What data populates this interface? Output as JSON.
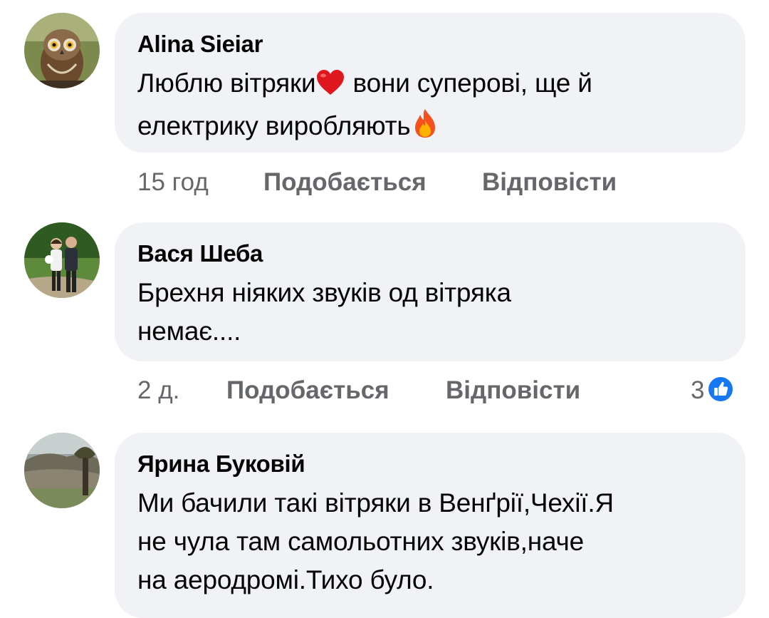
{
  "comments": [
    {
      "author": "Alina Sieiar",
      "line1_a": "Люблю вітряки",
      "line1_b": " вони суперові, ще й",
      "line2": "електрику виробляють",
      "time": "15 год",
      "like_label": "Подобається",
      "reply_label": "Відповісти",
      "emojis": [
        "heart-emoji",
        "fire-emoji"
      ],
      "avatar": "owl-avatar"
    },
    {
      "author": "Вася Шеба",
      "line1": "Брехня ніяких звуків од вітряка",
      "line2": "немає....",
      "time": "2 д.",
      "like_label": "Подобається",
      "reply_label": "Відповісти",
      "reaction_count": "3",
      "reaction_icon": "like-icon",
      "avatar": "couple-avatar"
    },
    {
      "author": "Ярина Буковій",
      "line1": "Ми бачили такі вітряки в Венґрії,Чехії.Я",
      "line2": "не чула там самольотних  звуків,наче",
      "line3": "на аеродромі.Тихо було.",
      "avatar": "landscape-avatar"
    }
  ],
  "colors": {
    "bubble": "#f0f2f5",
    "meta_text": "#65676b",
    "like_blue": "#1877f2"
  }
}
